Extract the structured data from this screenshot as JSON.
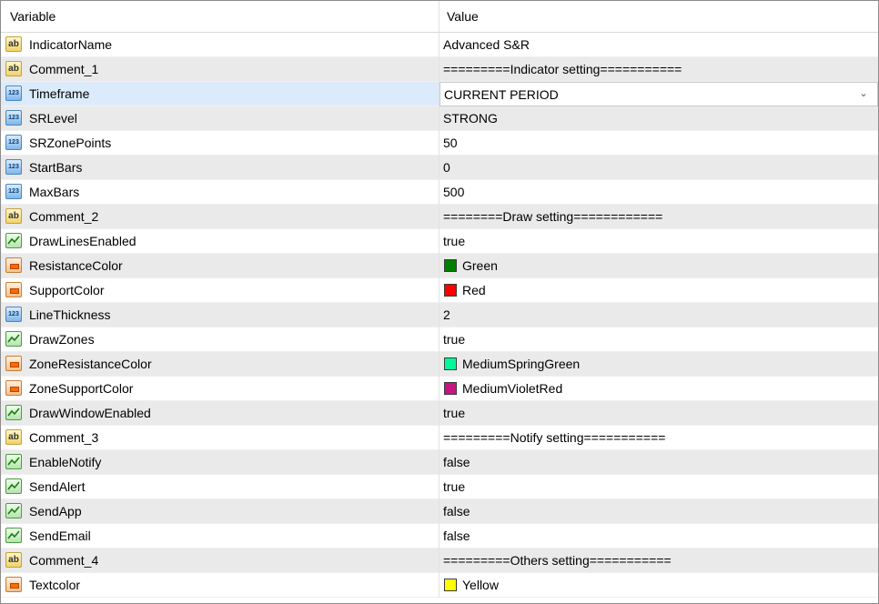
{
  "header": {
    "variable": "Variable",
    "value": "Value"
  },
  "rows": [
    {
      "name": "IndicatorName",
      "icon": "ab",
      "value": "Advanced S&R"
    },
    {
      "name": "Comment_1",
      "icon": "ab",
      "value": "=========Indicator setting==========="
    },
    {
      "name": "Timeframe",
      "icon": "num",
      "value": "CURRENT PERIOD",
      "selected": true,
      "dropdown": true
    },
    {
      "name": "SRLevel",
      "icon": "num",
      "value": "STRONG"
    },
    {
      "name": "SRZonePoints",
      "icon": "num",
      "value": "50"
    },
    {
      "name": "StartBars",
      "icon": "num",
      "value": "0"
    },
    {
      "name": "MaxBars",
      "icon": "num",
      "value": "500"
    },
    {
      "name": "Comment_2",
      "icon": "ab",
      "value": "========Draw setting============"
    },
    {
      "name": "DrawLinesEnabled",
      "icon": "bool",
      "value": "true"
    },
    {
      "name": "ResistanceColor",
      "icon": "color",
      "value": "Green",
      "swatch": "#008000"
    },
    {
      "name": "SupportColor",
      "icon": "color",
      "value": "Red",
      "swatch": "#ff0000"
    },
    {
      "name": "LineThickness",
      "icon": "num",
      "value": "2"
    },
    {
      "name": "DrawZones",
      "icon": "bool",
      "value": "true"
    },
    {
      "name": "ZoneResistanceColor",
      "icon": "color",
      "value": "MediumSpringGreen",
      "swatch": "#00fa9a"
    },
    {
      "name": "ZoneSupportColor",
      "icon": "color",
      "value": "MediumVioletRed",
      "swatch": "#c71585"
    },
    {
      "name": "DrawWindowEnabled",
      "icon": "bool",
      "value": "true"
    },
    {
      "name": "Comment_3",
      "icon": "ab",
      "value": "=========Notify setting==========="
    },
    {
      "name": "EnableNotify",
      "icon": "bool",
      "value": "false"
    },
    {
      "name": "SendAlert",
      "icon": "bool",
      "value": "true"
    },
    {
      "name": "SendApp",
      "icon": "bool",
      "value": "false"
    },
    {
      "name": "SendEmail",
      "icon": "bool",
      "value": "false"
    },
    {
      "name": "Comment_4",
      "icon": "ab",
      "value": "=========Others setting==========="
    },
    {
      "name": "Textcolor",
      "icon": "color",
      "value": "Yellow",
      "swatch": "#ffff00"
    }
  ],
  "icons": {
    "ab": {
      "glyph": "ab",
      "semantic": "string-type-icon"
    },
    "num": {
      "glyph": "123",
      "semantic": "integer-type-icon"
    },
    "bool": {
      "glyph": "",
      "semantic": "boolean-type-icon"
    },
    "color": {
      "glyph": "",
      "semantic": "color-type-icon"
    }
  },
  "dropdown_chevron": "⌄"
}
